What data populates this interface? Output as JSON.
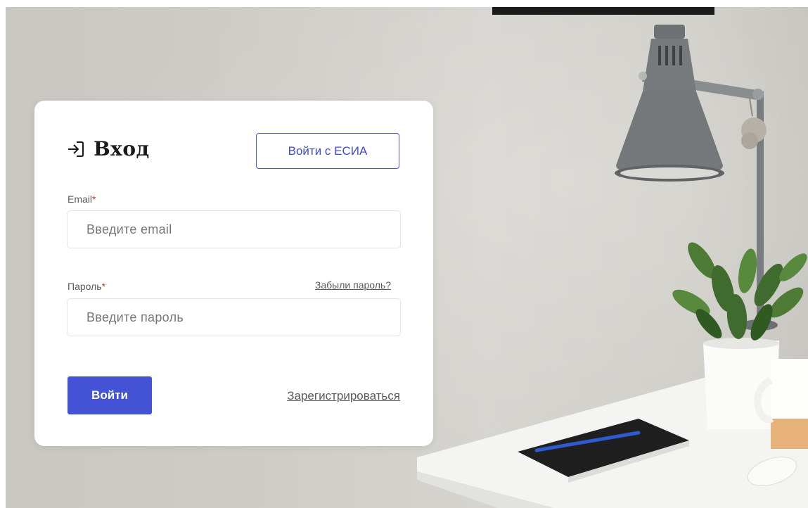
{
  "login": {
    "title": "Вход",
    "title_icon": "login-arrow-icon",
    "esia_button_label": "Войти с ЕСИА",
    "email": {
      "label": "Email",
      "required_mark": "*",
      "placeholder": "Введите email",
      "value": ""
    },
    "password": {
      "label": "Пароль",
      "required_mark": "*",
      "placeholder": "Введите пароль",
      "value": "",
      "forgot_link": "Забыли пароль?"
    },
    "submit_label": "Войти",
    "register_link": "Зарегистрироваться"
  },
  "colors": {
    "accent": "#4453d6",
    "required": "#c0392b",
    "card_background": "#ffffff",
    "wall": "#cfcdc7"
  }
}
